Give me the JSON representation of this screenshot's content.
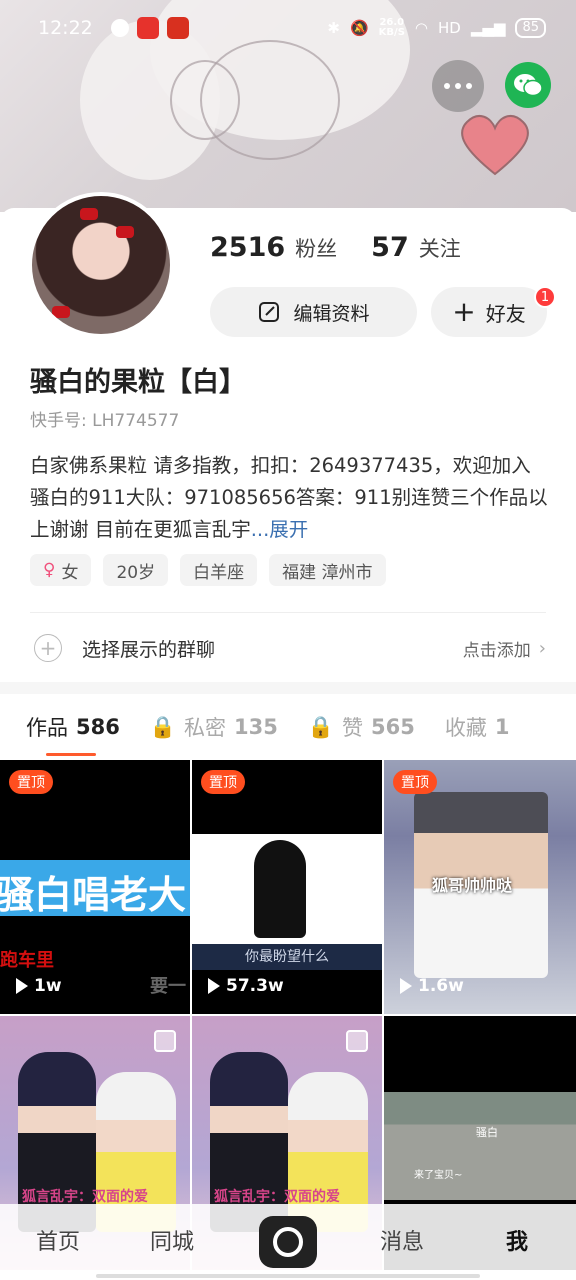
{
  "status_bar": {
    "time": "12:22",
    "speed_value": "26.0",
    "speed_unit": "KB/S",
    "network": "HD",
    "battery": "85"
  },
  "profile": {
    "followers_count": "2516",
    "followers_label": "粉丝",
    "following_count": "57",
    "following_label": "关注",
    "edit_label": "编辑资料",
    "friend_label": "好友",
    "friend_badge": "1",
    "name": "骚白的果粒【白】",
    "uid": "快手号: LH774577",
    "bio": "白家佛系果粒  请多指教，扣扣：2649377435，欢迎加入骚白的911大队：971085656答案：911别连赞三个作品以上谢谢 目前在更狐言乱宇",
    "bio_expand": "...展开",
    "tags": [
      "女",
      "20岁",
      "白羊座",
      "福建 漳州市"
    ],
    "group_label": "选择展示的群聊",
    "group_action": "点击添加"
  },
  "tabs": [
    {
      "label": "作品",
      "count": "586"
    },
    {
      "label": "私密",
      "count": "135"
    },
    {
      "label": "赞",
      "count": "565"
    },
    {
      "label": "收藏",
      "count": "1"
    }
  ],
  "videos": [
    {
      "pinned": "置顶",
      "views": "1w",
      "text_main": "骚白唱老大",
      "text_red": "跑车里",
      "text_gray": "要一"
    },
    {
      "pinned": "置顶",
      "views": "57.3w",
      "caption": "你最盼望什么"
    },
    {
      "pinned": "置顶",
      "views": "1.6w",
      "caption": "狐哥帅帅哒"
    },
    {
      "title": "狐言乱宇：双面的爱"
    },
    {
      "title": "狐言乱宇：双面的爱"
    },
    {
      "label": "骚白",
      "label2": "来了宝贝~"
    }
  ],
  "bottom_nav": {
    "home": "首页",
    "nearby": "同城",
    "messages": "消息",
    "me": "我"
  },
  "colors": {
    "accent": "#fe5a2c",
    "pin_badge": "#ff4e1f",
    "wechat": "#1fb554",
    "link": "#3a6fb0",
    "notify": "#fe3b3b"
  }
}
